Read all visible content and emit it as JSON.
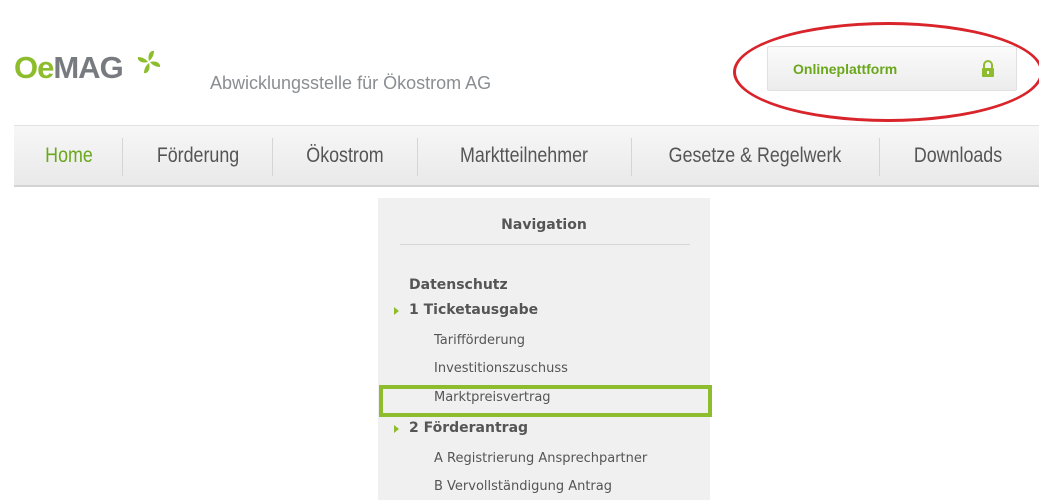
{
  "header": {
    "logo": {
      "part1": "Oe",
      "part2": "MAG"
    },
    "tagline": "Abwicklungsstelle für Ökostrom AG",
    "online_button": "Onlineplattform"
  },
  "mainnav": {
    "items": [
      "Home",
      "Förderung",
      "Ökostrom",
      "Marktteilnehmer",
      "Gesetze & Regelwerk",
      "Downloads"
    ],
    "active": "Home"
  },
  "sidenav": {
    "title": "Navigation",
    "entries": [
      {
        "label": "Datenschutz",
        "level": 1
      },
      {
        "label": "1 Ticketausgabe",
        "level": 1,
        "expanded": true
      },
      {
        "label": "Tarifförderung",
        "level": 2
      },
      {
        "label": "Investitionszuschuss",
        "level": 2
      },
      {
        "label": "Marktpreisvertrag",
        "level": 2,
        "highlighted": true
      },
      {
        "label": "2 Förderantrag",
        "level": 1,
        "expanded": true
      },
      {
        "label": "A Registrierung Ansprechpartner",
        "level": 2
      },
      {
        "label": "B Vervollständigung Antrag",
        "level": 2
      }
    ]
  },
  "colors": {
    "brand_green": "#8dbd2c",
    "annotation_red": "#d8242a"
  }
}
